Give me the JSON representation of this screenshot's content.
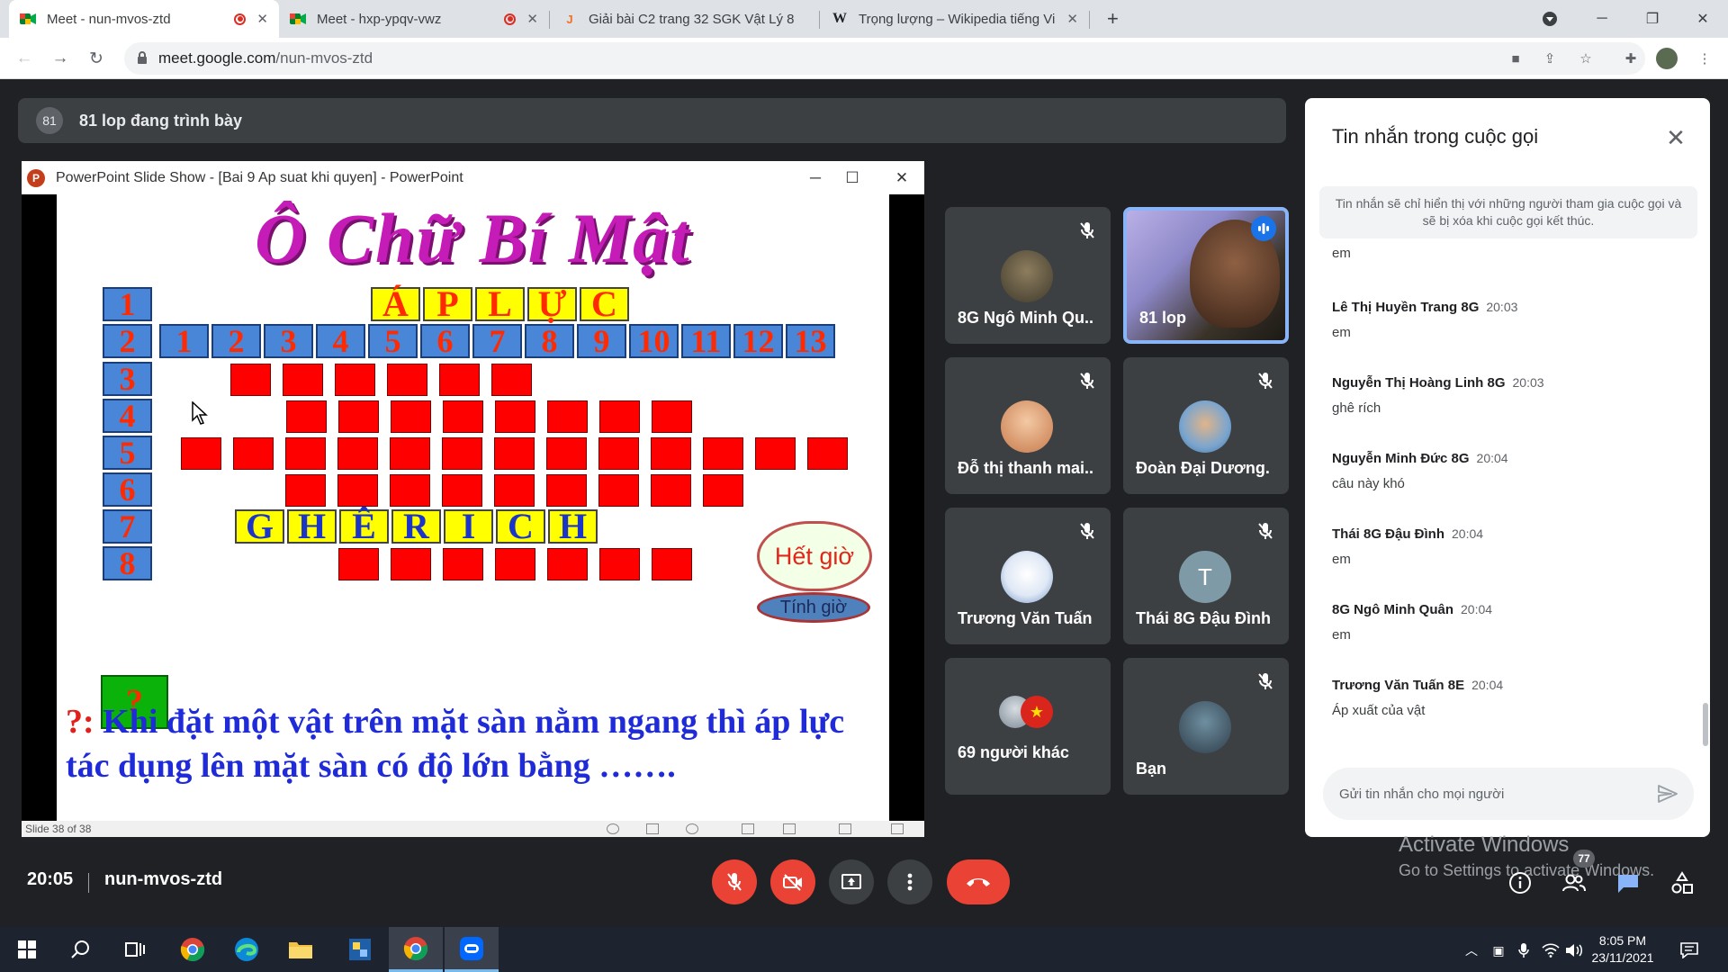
{
  "browser": {
    "tabs": [
      {
        "title": "Meet - nun-mvos-ztd",
        "favicon": "google-meet-icon",
        "recording": true,
        "active": true
      },
      {
        "title": "Meet - hxp-ypqv-vwz",
        "favicon": "google-meet-icon",
        "recording": true,
        "active": false
      },
      {
        "title": "Giải bài C2 trang 32 SGK Vật Lý 8",
        "favicon": "j-site-icon",
        "recording": false,
        "active": false
      },
      {
        "title": "Trọng lượng – Wikipedia tiếng Việt",
        "favicon": "wikipedia-icon",
        "recording": false,
        "active": false
      }
    ],
    "url": {
      "host": "meet.google.com",
      "path": "/nun-mvos-ztd"
    }
  },
  "presenter": {
    "badge": "81",
    "text": "81 lop đang trình bày"
  },
  "ppt": {
    "window_title": "PowerPoint Slide Show - [Bai 9 Ap suat khi quyen] - PowerPoint",
    "status": "Slide 38 of 38",
    "slide": {
      "title": "Ô Chữ Bí Mật",
      "row_numbers": [
        "1",
        "2",
        "3",
        "4",
        "5",
        "6",
        "7",
        "8"
      ],
      "row1_letters": [
        "Á",
        "P",
        "L",
        "Ự",
        "C"
      ],
      "column_numbers": [
        "1",
        "2",
        "3",
        "4",
        "5",
        "6",
        "7",
        "8",
        "9",
        "10",
        "11",
        "12",
        "13"
      ],
      "row7_letters": [
        "G",
        "H",
        "Ê",
        "R",
        "I",
        "C",
        "H"
      ],
      "question_box": "?",
      "timer_button": "Hết giờ",
      "timer_start_button": "Tính giờ",
      "question_mark": "?:",
      "question_text": "Khi đặt một vật trên mặt sàn nằm ngang thì áp lực tác dụng lên mặt sàn có độ lớn bằng ……."
    }
  },
  "participants": [
    {
      "name": "8G Ngô Minh Qu...",
      "muted": true
    },
    {
      "name": "81 lop",
      "speaking": true
    },
    {
      "name": "Đỗ thị thanh mai...",
      "muted": true
    },
    {
      "name": "Đoàn Đại Dương...",
      "muted": true
    },
    {
      "name": "Trương Văn Tuấn...",
      "muted": true
    },
    {
      "name": "Thái 8G Đậu Đình",
      "initial": "T",
      "muted": true
    },
    {
      "name": "69 người khác"
    },
    {
      "name": "Bạn",
      "muted": true
    }
  ],
  "chat": {
    "title": "Tin nhắn trong cuộc gọi",
    "notice": "Tin nhắn sẽ chỉ hiển thị với những người tham gia cuộc gọi và sẽ bị xóa khi cuộc gọi kết thúc.",
    "partial_message": "em",
    "messages": [
      {
        "sender": "Lê Thị Huyền Trang 8G",
        "time": "20:03",
        "text": "em"
      },
      {
        "sender": "Nguyễn Thị Hoàng Linh 8G",
        "time": "20:03",
        "text": "ghê rích"
      },
      {
        "sender": "Nguyễn Minh Đức 8G",
        "time": "20:04",
        "text": "câu này khó"
      },
      {
        "sender": "Thái 8G Đậu Đình",
        "time": "20:04",
        "text": "em"
      },
      {
        "sender": "8G Ngô Minh Quân",
        "time": "20:04",
        "text": "em"
      },
      {
        "sender": "Trương Văn Tuấn 8E",
        "time": "20:04",
        "text": "Áp xuất của vật"
      }
    ],
    "input_placeholder": "Gửi tin nhắn cho mọi người"
  },
  "watermark": {
    "line1": "Activate Windows",
    "line2": "Go to Settings to activate Windows."
  },
  "meeting": {
    "time": "20:05",
    "code": "nun-mvos-ztd",
    "people_count": "77"
  },
  "taskbar": {
    "time": "8:05 PM",
    "date": "23/11/2021"
  },
  "colors": {
    "accent": "#8ab4f8",
    "end_call": "#ea4335",
    "panel_dark": "#3c4043",
    "background": "#202124"
  }
}
